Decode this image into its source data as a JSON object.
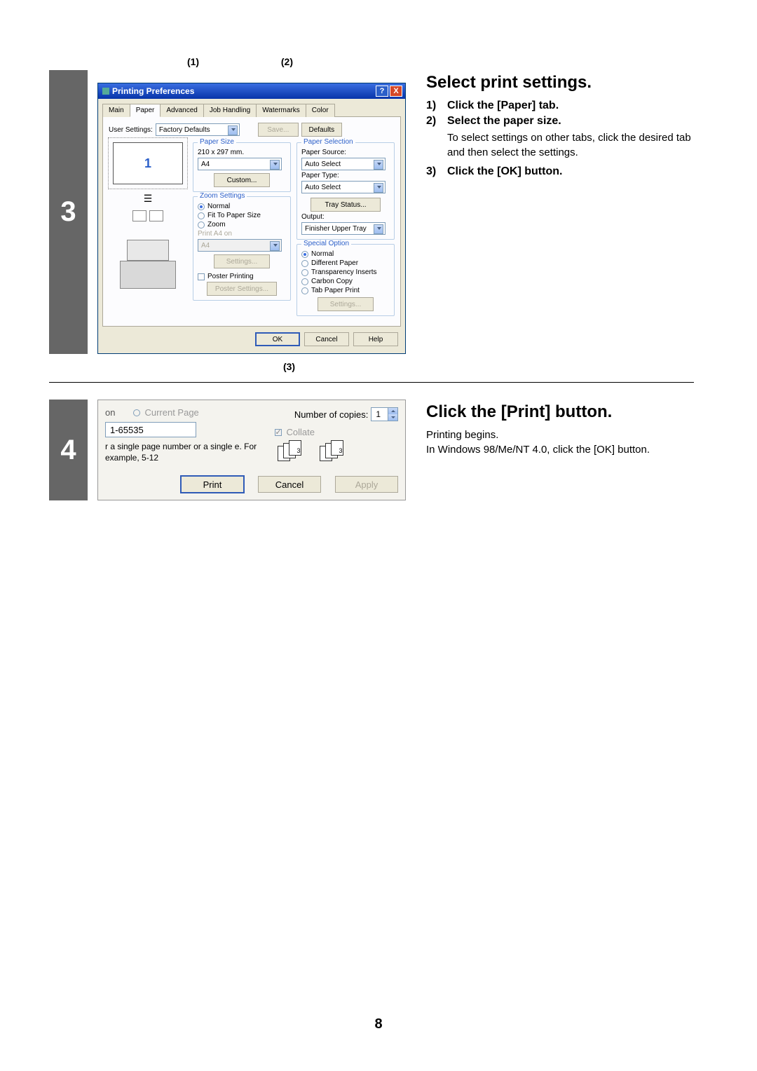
{
  "page_number": "8",
  "step3": {
    "number": "3",
    "heading": "Select print settings.",
    "callout1": "(1)",
    "callout2": "(2)",
    "callout3": "(3)",
    "substeps": [
      {
        "n": "1)",
        "text": "Click the [Paper] tab."
      },
      {
        "n": "2)",
        "text": "Select the paper size."
      },
      {
        "detail": "To select settings on other tabs, click the desired tab and then select the settings."
      },
      {
        "n": "3)",
        "text": "Click the [OK] button."
      }
    ],
    "dialog": {
      "title": "Printing Preferences",
      "tabs": [
        "Main",
        "Paper",
        "Advanced",
        "Job Handling",
        "Watermarks",
        "Color"
      ],
      "active_tab": "Paper",
      "user_settings_label": "User Settings:",
      "user_settings_value": "Factory Defaults",
      "btn_save": "Save...",
      "btn_defaults": "Defaults",
      "preview_number": "1",
      "paper_size_group": "Paper Size",
      "paper_size_dims": "210 x 297 mm.",
      "paper_size_value": "A4",
      "btn_custom": "Custom...",
      "zoom_group": "Zoom Settings",
      "zoom_normal": "Normal",
      "zoom_fit": "Fit To Paper Size",
      "zoom_zoom": "Zoom",
      "print_a4_on_label": "Print A4 on",
      "print_a4_on_value": "A4",
      "btn_settings_zoom": "Settings...",
      "poster_label": "Poster Printing",
      "btn_poster_settings": "Poster Settings...",
      "paper_selection_group": "Paper Selection",
      "paper_source_label": "Paper Source:",
      "paper_source_value": "Auto Select",
      "paper_type_label": "Paper Type:",
      "paper_type_value": "Auto Select",
      "btn_tray_status": "Tray Status...",
      "output_label": "Output:",
      "output_value": "Finisher Upper Tray",
      "special_group": "Special Option",
      "sp_normal": "Normal",
      "sp_diff": "Different Paper",
      "sp_trans": "Transparency Inserts",
      "sp_carbon": "Carbon Copy",
      "sp_tab": "Tab Paper Print",
      "btn_sp_settings": "Settings...",
      "btn_ok": "OK",
      "btn_cancel": "Cancel",
      "btn_help": "Help"
    }
  },
  "step4": {
    "number": "4",
    "heading": "Click the [Print] button.",
    "body1": "Printing begins.",
    "body2": "In Windows 98/Me/NT 4.0, click the [OK] button.",
    "snippet": {
      "radio_current": "Current Page",
      "copies_label": "Number of copies:",
      "copies_value": "1",
      "range_value": "1-65535",
      "hint": "r a single page number or a single e.  For example, 5-12",
      "collate_label": "Collate",
      "btn_print": "Print",
      "btn_cancel": "Cancel",
      "btn_apply": "Apply",
      "on_label": "on"
    }
  }
}
